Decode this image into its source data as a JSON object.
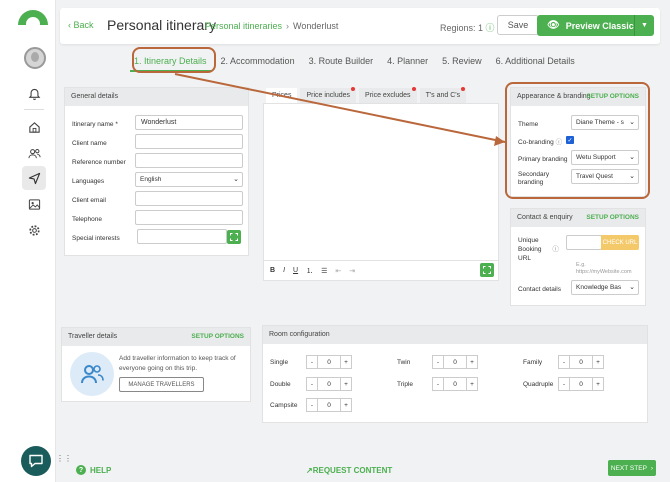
{
  "topbar": {
    "back_label": "Back",
    "title": "Personal itinerary",
    "breadcrumb_link": "Personal itineraries",
    "breadcrumb_current": "Wonderlust",
    "regions_label": "Regions: 1",
    "save_label": "Save",
    "preview_label": "Preview Classic"
  },
  "steps": [
    "1. Itinerary Details",
    "2. Accommodation",
    "3. Route Builder",
    "4. Planner",
    "5. Review",
    "6. Additional Details"
  ],
  "general": {
    "heading": "General details",
    "itinerary_name_label": "Itinerary name *",
    "itinerary_name_value": "Wonderlust",
    "client_name_label": "Client name",
    "reference_label": "Reference number",
    "languages_label": "Languages",
    "languages_value": "English",
    "client_email_label": "Client email",
    "telephone_label": "Telephone",
    "special_interests_label": "Special interests"
  },
  "editor_tabs": [
    "Prices",
    "Price includes",
    "Price excludes",
    "T's and C's"
  ],
  "appearance": {
    "heading": "Appearance & branding",
    "setup": "SETUP OPTIONS",
    "theme_label": "Theme",
    "theme_value": "Diane Theme - s",
    "cobranding_label": "Co-branding",
    "primary_label": "Primary branding",
    "primary_value": "Wetu Support",
    "secondary_label_1": "Secondary",
    "secondary_label_2": "branding",
    "secondary_value": "Travel Quest"
  },
  "contact": {
    "heading": "Contact & enquiry",
    "setup": "SETUP OPTIONS",
    "url_label_1": "Unique",
    "url_label_2": "Booking",
    "url_label_3": "URL",
    "check_url": "CHECK URL",
    "hint_1": "E.g.",
    "hint_2": "https://myWebsite.com",
    "details_label": "Contact details",
    "details_value": "Knowledge Bas"
  },
  "traveller": {
    "heading": "Traveller details",
    "setup": "SETUP OPTIONS",
    "text_1": "Add traveller information to keep track of",
    "text_2": "everyone going on this trip.",
    "manage": "MANAGE TRAVELLERS"
  },
  "rooms": {
    "heading": "Room configuration",
    "items": [
      {
        "label": "Single",
        "value": "0"
      },
      {
        "label": "Twin",
        "value": "0"
      },
      {
        "label": "Family",
        "value": "0"
      },
      {
        "label": "Double",
        "value": "0"
      },
      {
        "label": "Triple",
        "value": "0"
      },
      {
        "label": "Quadruple",
        "value": "0"
      },
      {
        "label": "Campsite",
        "value": "0"
      }
    ]
  },
  "bottom": {
    "help": "HELP",
    "request": "REQUEST CONTENT",
    "next": "NEXT STEP"
  },
  "colors": {
    "accent": "#4caf50",
    "highlight": "#b9673b"
  }
}
